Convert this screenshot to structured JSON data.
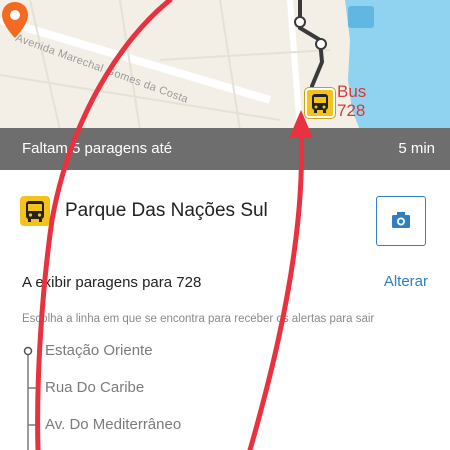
{
  "map": {
    "street_label": "Avenida Marechal Gomes da Costa",
    "bus_label_line1": "Bus",
    "bus_label_line2": "728"
  },
  "header": {
    "stops_text": "Faltam 5 paragens até",
    "time_text": "5 min"
  },
  "stop": {
    "icon": "bus-icon",
    "name": "Parque Das Nações Sul",
    "camera_icon": "camera-icon"
  },
  "filter": {
    "showing_text": "A exibir paragens para 728",
    "change_label": "Alterar"
  },
  "hint": "Escolha a linha em que se encontra para receber os alertas para sair",
  "stops_list": [
    "Estação Oriente",
    "Rua Do Caribe",
    "Av. Do Mediterrâneo"
  ],
  "colors": {
    "header_bg": "#6e6e6e",
    "accent_blue": "#2f7fc1",
    "bus_yellow": "#f4c21d",
    "annotation_red": "#e8323f",
    "pin_orange": "#f36b22"
  }
}
